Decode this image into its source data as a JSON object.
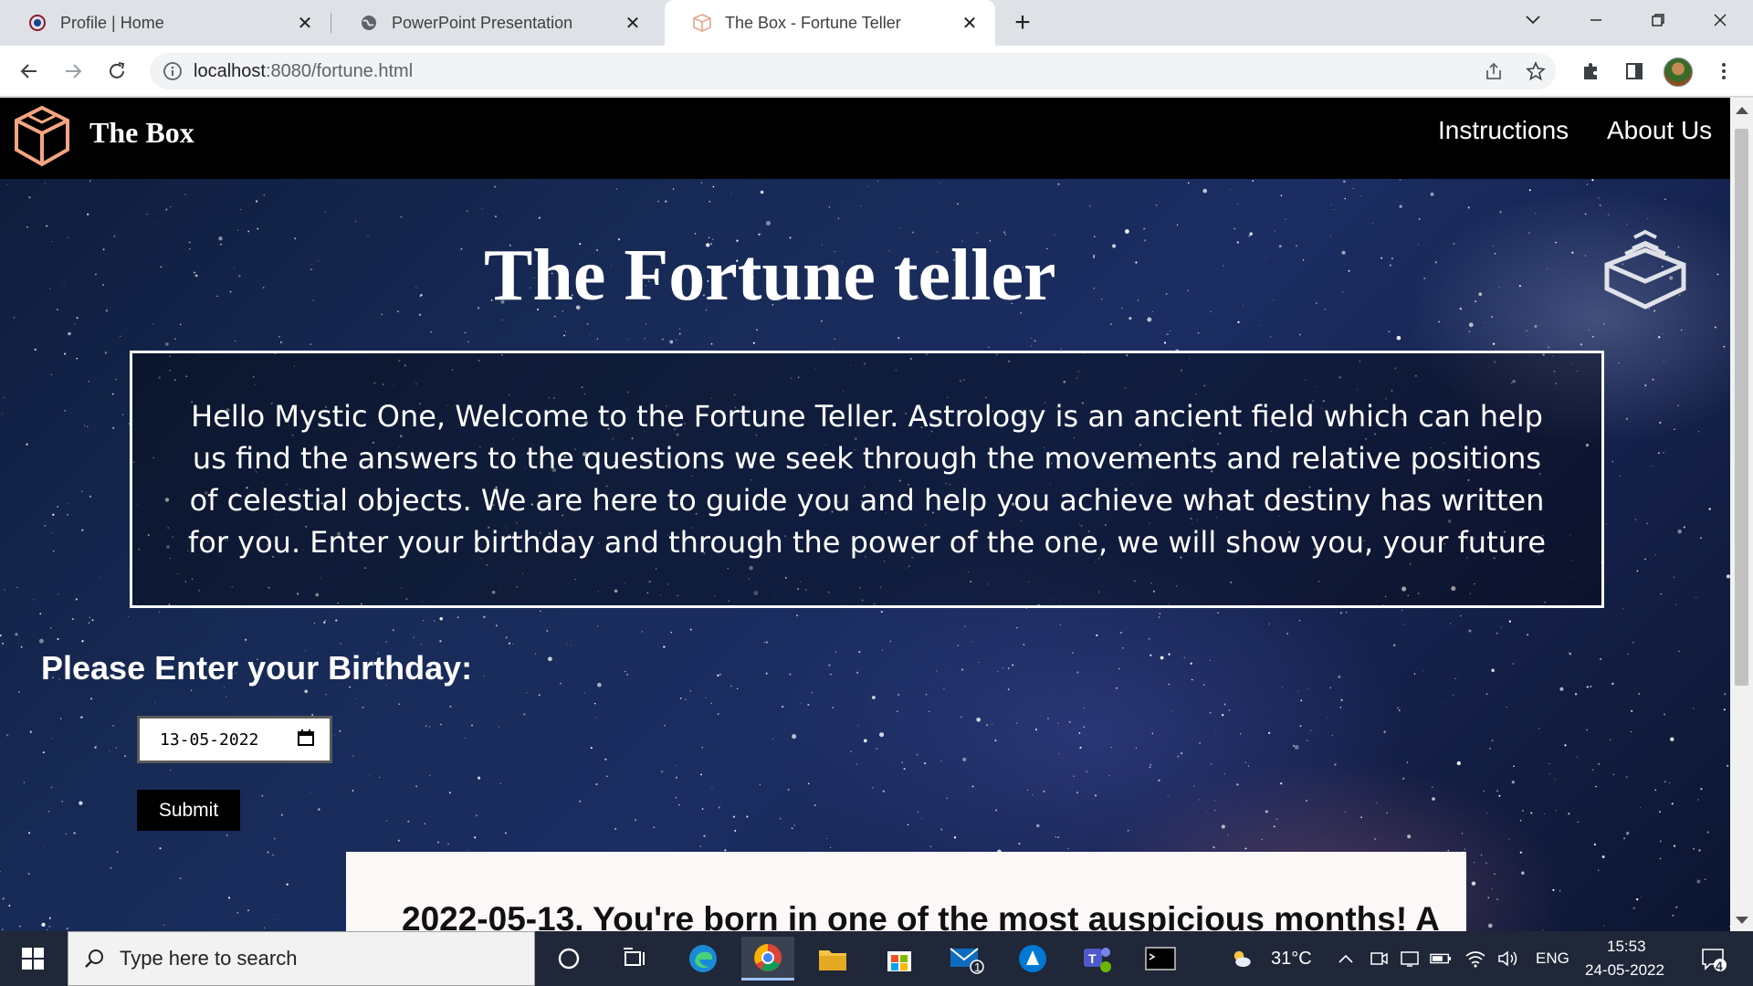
{
  "browser": {
    "tabs": [
      {
        "title": "Profile | Home",
        "icon": "profile-favicon",
        "active": false
      },
      {
        "title": "PowerPoint Presentation",
        "icon": "globe-icon",
        "active": false
      },
      {
        "title": "The Box - Fortune Teller",
        "icon": "box-favicon",
        "active": true
      }
    ],
    "new_tab_label": "+",
    "url": {
      "host": "localhost",
      "path": ":8080/fortune.html"
    }
  },
  "site": {
    "brand": "The Box",
    "nav": [
      {
        "label": "Instructions"
      },
      {
        "label": "About Us"
      }
    ],
    "accent_color": "#f4a582"
  },
  "page": {
    "title": "The Fortune teller",
    "intro": "Hello Mystic One, Welcome to the Fortune Teller. Astrology is an ancient field which can help us find the answers to the questions we seek through the movements and relative positions of celestial objects. We are here to guide you and help you achieve what destiny has written for you. Enter your birthday and through the power of the one, we will show you, your future",
    "birthday_label": "Please Enter your Birthday:",
    "birthday_value": "13-05-2022",
    "submit_label": "Submit",
    "result_text": "2022-05-13. You're born in one of the most auspicious months! A"
  },
  "taskbar": {
    "search_placeholder": "Type here to search",
    "mail_badge": "1",
    "weather": "31°C",
    "language": "ENG",
    "time": "15:53",
    "date": "24-05-2022",
    "notification_count": "4"
  }
}
